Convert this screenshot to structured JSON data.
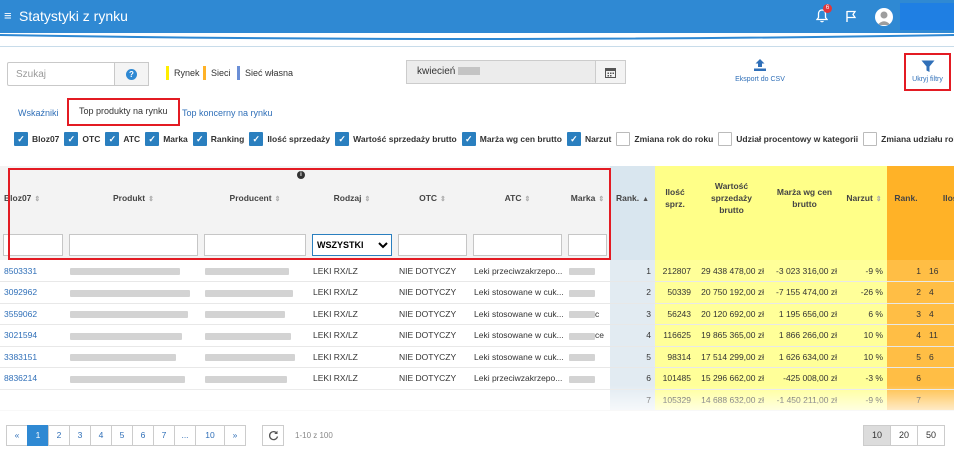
{
  "app": {
    "title": "Statystyki z rynku",
    "notifications": "6"
  },
  "search": {
    "placeholder": "Szukaj",
    "help": "?"
  },
  "legend": [
    {
      "label": "Rynek",
      "color": "#ffee00"
    },
    {
      "label": "Sieci",
      "color": "#ffb227"
    },
    {
      "label": "Sieć własna",
      "color": "#6b8fd6"
    }
  ],
  "month": {
    "value": "kwiecień"
  },
  "toolbar": {
    "export_label": "Eksport do CSV",
    "hide_filters_label": "Ukryj filtry"
  },
  "tabs": [
    {
      "label": "Wskaźniki"
    },
    {
      "label": "Top produkty na rynku"
    },
    {
      "label": "Top koncerny na rynku"
    }
  ],
  "column_toggles": [
    {
      "label": "Bloz07",
      "checked": true
    },
    {
      "label": "OTC",
      "checked": true
    },
    {
      "label": "ATC",
      "checked": true
    },
    {
      "label": "Marka",
      "checked": true
    },
    {
      "label": "Ranking",
      "checked": true
    },
    {
      "label": "Ilość sprzedaży",
      "checked": true
    },
    {
      "label": "Wartość sprzedaży brutto",
      "checked": true
    },
    {
      "label": "Marża wg cen brutto",
      "checked": true
    },
    {
      "label": "Narzut",
      "checked": true
    },
    {
      "label": "Zmiana rok do roku",
      "checked": false
    },
    {
      "label": "Udział procentowy w kategorii",
      "checked": false
    },
    {
      "label": "Zmiana udziału rok do roku",
      "checked": false
    }
  ],
  "table": {
    "headers": [
      "Bloz07",
      "Produkt",
      "Producent",
      "Rodzaj",
      "OTC",
      "ATC",
      "Marka",
      "Rank.",
      "Ilość sprz.",
      "Wartość sprzedaży brutto",
      "Marża wg cen brutto",
      "Narzut",
      "Rank.",
      "Ilość sprz"
    ],
    "rodzaj_filter": "WSZYSTKI",
    "rows": [
      {
        "bloz": "8503331",
        "rodzaj": "LEKI RX/LZ",
        "otc": "NIE DOTYCZY",
        "atc": "Leki przeciwzakrzepo...",
        "marka_tail": "",
        "rank": "1",
        "qty": "212807",
        "value": "29 438 478,00 zł",
        "margin": "-3 023 316,00 zł",
        "markup": "-9 %",
        "rank2": "1",
        "qty2": "16"
      },
      {
        "bloz": "3092962",
        "rodzaj": "LEKI RX/LZ",
        "otc": "NIE DOTYCZY",
        "atc": "Leki stosowane w cuk...",
        "marka_tail": "",
        "rank": "2",
        "qty": "50339",
        "value": "20 750 192,00 zł",
        "margin": "-7 155 474,00 zł",
        "markup": "-26 %",
        "rank2": "2",
        "qty2": "4"
      },
      {
        "bloz": "3559062",
        "rodzaj": "LEKI RX/LZ",
        "otc": "NIE DOTYCZY",
        "atc": "Leki stosowane w cuk...",
        "marka_tail": "c",
        "rank": "3",
        "qty": "56243",
        "value": "20 120 692,00 zł",
        "margin": "1 195 656,00 zł",
        "markup": "6 %",
        "rank2": "3",
        "qty2": "4"
      },
      {
        "bloz": "3021594",
        "rodzaj": "LEKI RX/LZ",
        "otc": "NIE DOTYCZY",
        "atc": "Leki stosowane w cuk...",
        "marka_tail": "ce",
        "rank": "4",
        "qty": "116625",
        "value": "19 865 365,00 zł",
        "margin": "1 866 266,00 zł",
        "markup": "10 %",
        "rank2": "4",
        "qty2": "11"
      },
      {
        "bloz": "3383151",
        "rodzaj": "LEKI RX/LZ",
        "otc": "NIE DOTYCZY",
        "atc": "Leki stosowane w cuk...",
        "marka_tail": "",
        "rank": "5",
        "qty": "98314",
        "value": "17 514 299,00 zł",
        "margin": "1 626 634,00 zł",
        "markup": "10 %",
        "rank2": "5",
        "qty2": "6"
      },
      {
        "bloz": "8836214",
        "rodzaj": "LEKI RX/LZ",
        "otc": "NIE DOTYCZY",
        "atc": "Leki przeciwzakrzepo...",
        "marka_tail": "",
        "rank": "6",
        "qty": "101485",
        "value": "15 296 662,00 zł",
        "margin": "-425 008,00 zł",
        "markup": "-3 %",
        "rank2": "6",
        "qty2": ""
      },
      {
        "bloz": "",
        "rodzaj": "",
        "otc": "",
        "atc": "",
        "marka_tail": "",
        "rank": "7",
        "qty": "105329",
        "value": "14 688 632,00 zł",
        "margin": "-1 450 211,00 zł",
        "markup": "-9 %",
        "rank2": "7",
        "qty2": ""
      }
    ]
  },
  "pagination": {
    "pages": [
      "«",
      "1",
      "2",
      "3",
      "4",
      "5",
      "6",
      "7",
      "...",
      "10",
      "»"
    ],
    "range": "1-10 z 100",
    "sizes": [
      "10",
      "20",
      "50"
    ]
  }
}
